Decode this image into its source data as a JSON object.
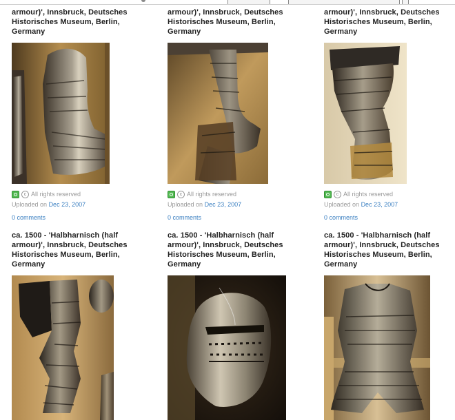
{
  "items": [
    {
      "title_lines": [
        "armour)', Innsbruck, Deutsches",
        "Historisches Museum, Berlin,",
        "Germany"
      ],
      "rights": "All rights reserved",
      "uploaded_prefix": "Uploaded on",
      "uploaded_date": "Dec 23, 2007",
      "comments": "0 comments"
    },
    {
      "title_lines": [
        "armour)', Innsbruck, Deutsches",
        "Historisches Museum, Berlin,",
        "Germany"
      ],
      "rights": "All rights reserved",
      "uploaded_prefix": "Uploaded on",
      "uploaded_date": "Dec 23, 2007",
      "comments": "0 comments"
    },
    {
      "title_lines": [
        "armour)', Innsbruck, Deutsches",
        "Historisches Museum, Berlin,",
        "Germany"
      ],
      "rights": "All rights reserved",
      "uploaded_prefix": "Uploaded on",
      "uploaded_date": "Dec 23, 2007",
      "comments": "0 comments"
    },
    {
      "title_lines": [
        "ca. 1500 - 'Halbharnisch (half",
        "armour)', Innsbruck, Deutsches",
        "Historisches Museum, Berlin,",
        "Germany"
      ]
    },
    {
      "title_lines": [
        "ca. 1500 - 'Halbharnisch (half",
        "armour)', Innsbruck, Deutsches",
        "Historisches Museum, Berlin,",
        "Germany"
      ]
    },
    {
      "title_lines": [
        "ca. 1500 - 'Halbharnisch (half",
        "armour)', Innsbruck, Deutsches",
        "Historisches Museum, Berlin,",
        "Germany"
      ]
    }
  ],
  "icons": {
    "license": "cc-license-icon",
    "copyright": "copyright-icon"
  },
  "colors": {
    "link": "#3a7fc1",
    "meta_text": "#999999",
    "title_text": "#222222"
  }
}
